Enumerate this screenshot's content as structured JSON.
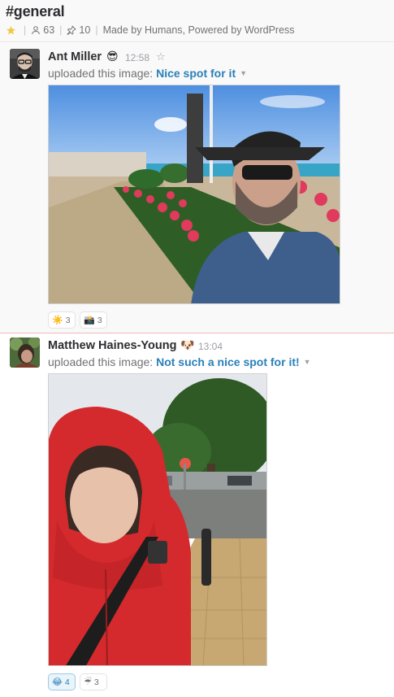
{
  "channel": {
    "name": "#general",
    "members_count": "63",
    "pins_count": "10",
    "topic": "Made by Humans, Powered by WordPress"
  },
  "messages": [
    {
      "author": "Ant Miller",
      "status_emoji": "😎",
      "time": "12:58",
      "upload_prefix": "uploaded this image:",
      "image_title": "Nice spot for it",
      "reactions": [
        {
          "emoji": "☀️",
          "count": "3"
        },
        {
          "emoji": "📸",
          "count": "3"
        }
      ]
    },
    {
      "author": "Matthew Haines-Young",
      "status_emoji": "🐶",
      "time": "13:04",
      "upload_prefix": "uploaded this image:",
      "image_title": "Not such a nice spot for it!",
      "reactions": [
        {
          "emoji": "😂",
          "count": "4"
        },
        {
          "emoji": "☔",
          "count": "3"
        }
      ]
    }
  ],
  "colors": {
    "link": "#2a80b9",
    "star": "#f2c744",
    "unread_divider": "#f0b8b8"
  },
  "icons": [
    "star-icon",
    "members-icon",
    "pin-icon",
    "star-outline-icon",
    "caret-down-icon"
  ]
}
